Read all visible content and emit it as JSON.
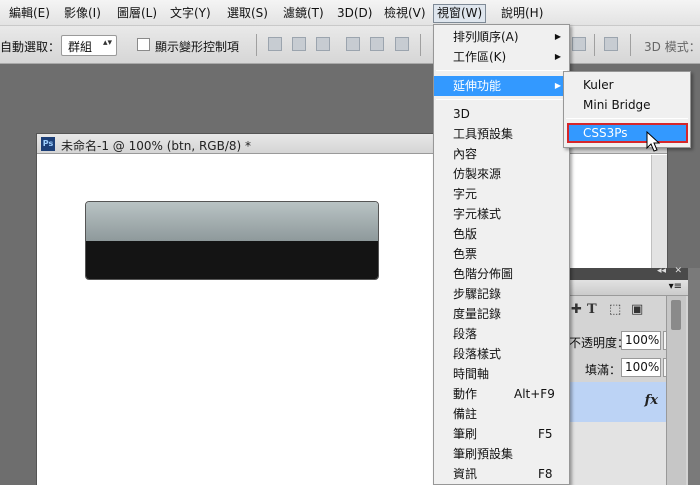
{
  "menubar": {
    "items": [
      "編輯(E)",
      "影像(I)",
      "圖層(L)",
      "文字(Y)",
      "選取(S)",
      "濾鏡(T)",
      "3D(D)",
      "檢視(V)",
      "視窗(W)",
      "說明(H)"
    ],
    "active": "視窗(W)"
  },
  "options": {
    "auto_select_label": "自動選取：",
    "auto_select_value": "群組",
    "show_transform_label": "顯示變形控制項",
    "mode_label": "3D 模式："
  },
  "document": {
    "title": "未命名-1 @ 100% (btn, RGB/8) *",
    "app_icon": "Ps"
  },
  "panel": {
    "opacity_label": "不透明度：",
    "opacity_value": "100%",
    "fill_label": "填滿：",
    "fill_value": "100%",
    "fx_label": "fx",
    "icons": [
      "lock-position-icon",
      "text-icon",
      "transform-icon",
      "artboard-icon",
      "lock-icon"
    ]
  },
  "window_menu": {
    "items": [
      {
        "label": "排列順序(A)",
        "submenu": true
      },
      {
        "label": "工作區(K)",
        "submenu": true
      },
      {
        "label": "延伸功能",
        "submenu": true,
        "highlight": true
      },
      {
        "label": "3D"
      },
      {
        "label": "工具預設集"
      },
      {
        "label": "內容"
      },
      {
        "label": "仿製來源"
      },
      {
        "label": "字元"
      },
      {
        "label": "字元樣式"
      },
      {
        "label": "色版"
      },
      {
        "label": "色票"
      },
      {
        "label": "色階分佈圖"
      },
      {
        "label": "步驟記錄"
      },
      {
        "label": "度量記錄"
      },
      {
        "label": "段落"
      },
      {
        "label": "段落樣式"
      },
      {
        "label": "時間軸"
      },
      {
        "label": "動作",
        "shortcut": "Alt+F9"
      },
      {
        "label": "備註"
      },
      {
        "label": "筆刷",
        "shortcut": "F5"
      },
      {
        "label": "筆刷預設集"
      },
      {
        "label": "資訊",
        "shortcut": "F8"
      }
    ]
  },
  "extensions_submenu": {
    "items": [
      "Kuler",
      "Mini Bridge",
      "CSS3Ps"
    ],
    "selected": "CSS3Ps"
  },
  "colors": {
    "highlight": "#3399ff",
    "selection_border": "#d6262a",
    "layer_selected": "#bcd3f5"
  }
}
